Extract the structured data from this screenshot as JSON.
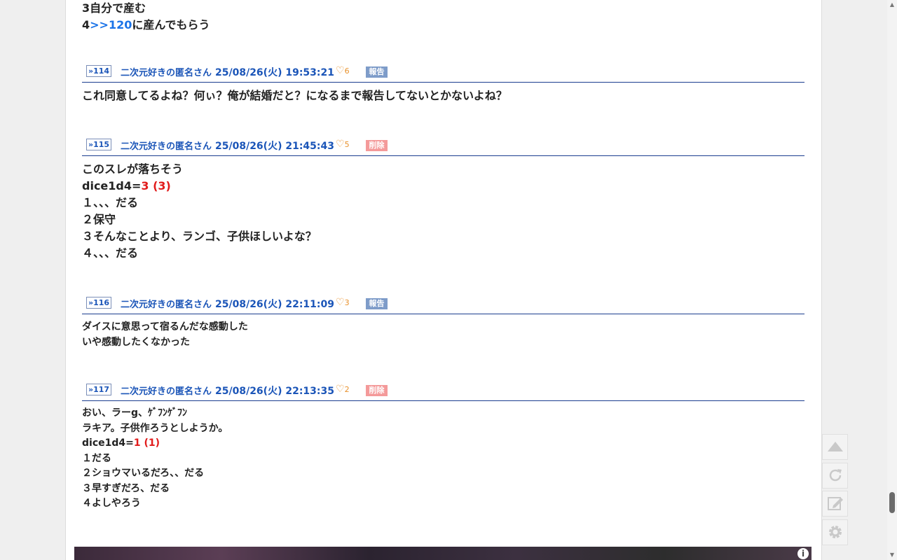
{
  "top_lines": {
    "line3": "3自分で産む",
    "line4_prefix": "4",
    "line4_link": ">>120",
    "line4_suffix": "に産んでもらう"
  },
  "posts": [
    {
      "anchor": "»114",
      "name": "二次元好きの匿名さん",
      "date": "25/08/26(火) 19:53:21",
      "likes": "6",
      "badge": "報告",
      "body": [
        "これ同意してるよね？何ぃ？俺が結婚だと？になるまで報告してないとかないよね？"
      ]
    },
    {
      "anchor": "»115",
      "name": "二次元好きの匿名さん",
      "date": "25/08/26(火) 21:45:43",
      "likes": "5",
      "badge": "削除",
      "body_first": "このスレが落ちそう",
      "dice_prefix": "dice1d4=",
      "dice_result": "3 (3)",
      "body_rest": [
        "１、、、だる",
        "２保守",
        "３そんなことより、ランゴ、子供ほしいよな？",
        "４、、、だる"
      ]
    },
    {
      "anchor": "»116",
      "name": "二次元好きの匿名さん",
      "date": "25/08/26(火) 22:11:09",
      "likes": "3",
      "badge": "報告",
      "body": [
        "ダイスに意思って宿るんだな感動した",
        "いや感動したくなかった"
      ]
    },
    {
      "anchor": "»117",
      "name": "二次元好きの匿名さん",
      "date": "25/08/26(火) 22:13:35",
      "likes": "2",
      "badge": "削除",
      "body_first": [
        "おい、ラーg、ｹﾞﾌﾝｹﾞﾌﾝ",
        "ラキア。子供作ろうとしようか。"
      ],
      "dice_prefix": "dice1d4=",
      "dice_result": "1 (1)",
      "body_rest": [
        "１だる",
        "２ショウマいるだろ、、だる",
        "３早すぎだろ、だる",
        "４よしやろう"
      ]
    }
  ],
  "side_buttons": {
    "top": "scroll-top-icon",
    "reload": "reload-icon",
    "write": "edit-icon",
    "settings": "gear-icon"
  },
  "colors": {
    "link_blue": "#1a73e8",
    "dice_red": "#e11b1b",
    "header_blue": "#1b55b8",
    "report_badge": "#7e9cc9",
    "delete_badge": "#f49a9a"
  }
}
